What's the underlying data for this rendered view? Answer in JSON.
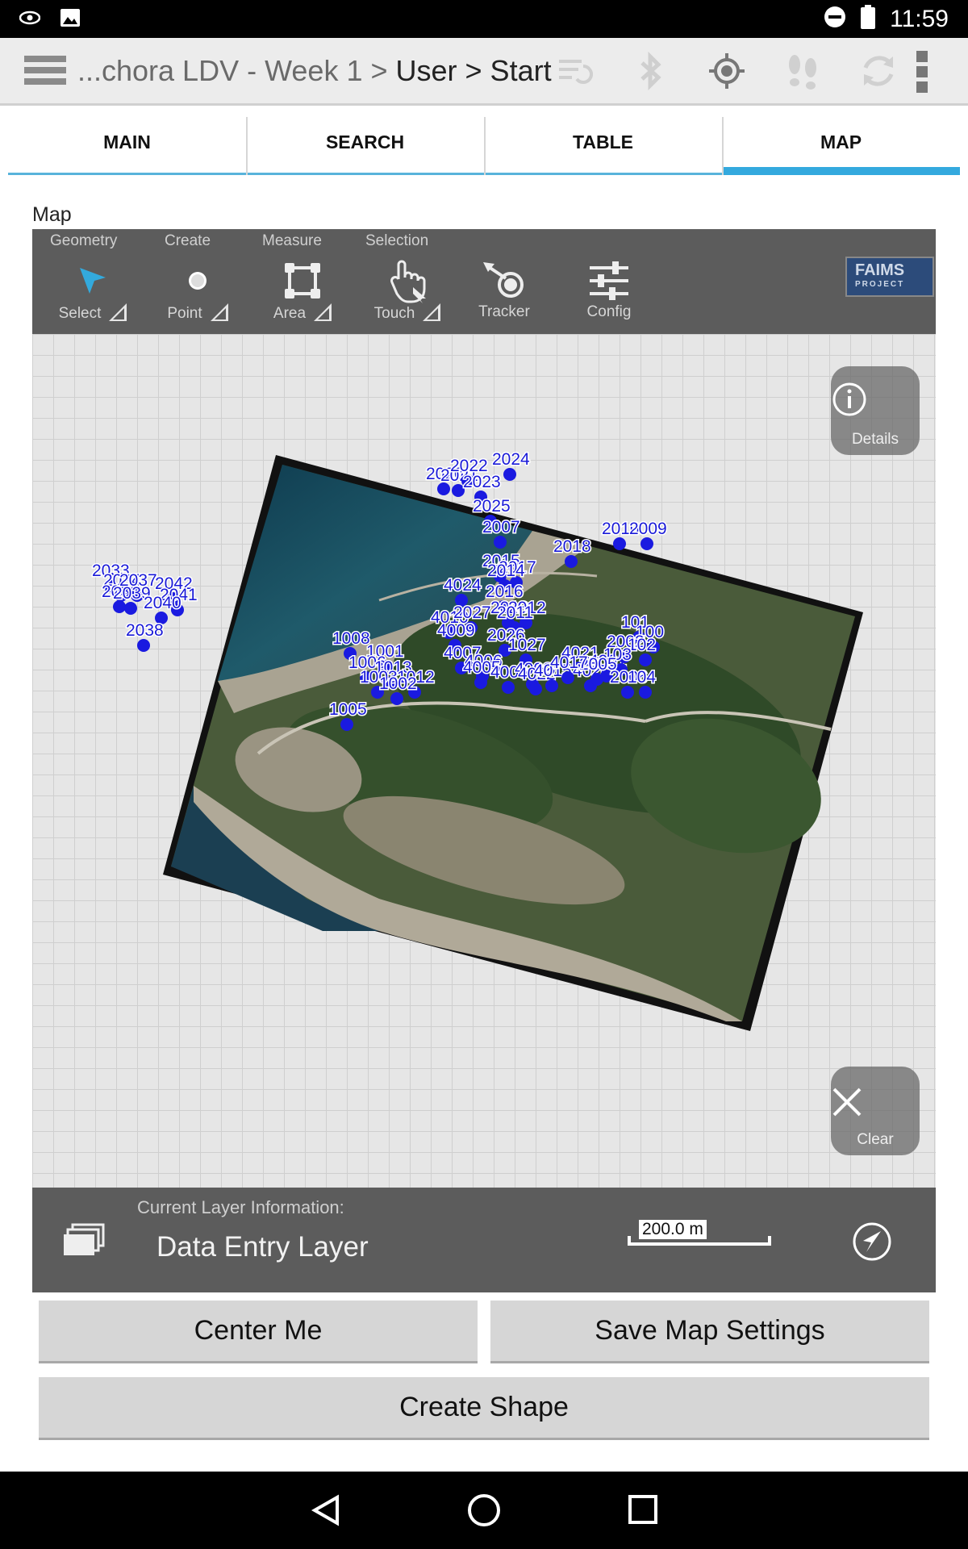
{
  "status_bar": {
    "time": "11:59"
  },
  "app_bar": {
    "breadcrumb_prefix": "...chora LDV - Week 1 > ",
    "breadcrumb_current": "User > Start"
  },
  "tabs": [
    {
      "label": "MAIN",
      "active": false
    },
    {
      "label": "SEARCH",
      "active": false
    },
    {
      "label": "TABLE",
      "active": false
    },
    {
      "label": "MAP",
      "active": true
    }
  ],
  "map": {
    "section_label": "Map",
    "toolbar": {
      "groups": [
        "Geometry",
        "Create",
        "Measure",
        "Selection"
      ],
      "tools": [
        {
          "label": "Select",
          "icon": "select-arrow-icon"
        },
        {
          "label": "Point",
          "icon": "point-icon"
        },
        {
          "label": "Area",
          "icon": "area-icon"
        },
        {
          "label": "Touch",
          "icon": "touch-icon"
        },
        {
          "label": "Tracker",
          "icon": "tracker-icon"
        },
        {
          "label": "Config",
          "icon": "config-sliders-icon"
        }
      ],
      "logo_text": "FAIMS",
      "logo_sub": "PROJECT"
    },
    "details_label": "Details",
    "clear_label": "Clear",
    "point_labels": [
      "2033",
      "2034",
      "2036",
      "2037",
      "2039",
      "2042",
      "2041",
      "2040",
      "2038",
      "2020",
      "2021",
      "2022",
      "2023",
      "2024",
      "2025",
      "2007",
      "2010",
      "2009",
      "2018",
      "2015",
      "2017",
      "2014",
      "4024",
      "2016",
      "2013",
      "2012",
      "2011",
      "4010",
      "2027",
      "4009",
      "2026",
      "1008",
      "1001",
      "1006",
      "1013",
      "1003",
      "1012",
      "1002",
      "1005",
      "4007",
      "4006",
      "1027",
      "4005",
      "4003",
      "4002",
      "4021",
      "4022",
      "4020",
      "4015",
      "4001",
      "101",
      "100",
      "2002",
      "102",
      "103",
      "2006",
      "104",
      "2005",
      "4017"
    ],
    "accent_point_color": "#1a1ae0"
  },
  "layer_info": {
    "title": "Current Layer Information:",
    "layer_name": "Data Entry Layer",
    "scale_label": "200.0 m"
  },
  "buttons": {
    "center_me": "Center Me",
    "save_map_settings": "Save Map Settings",
    "create_shape": "Create Shape"
  }
}
